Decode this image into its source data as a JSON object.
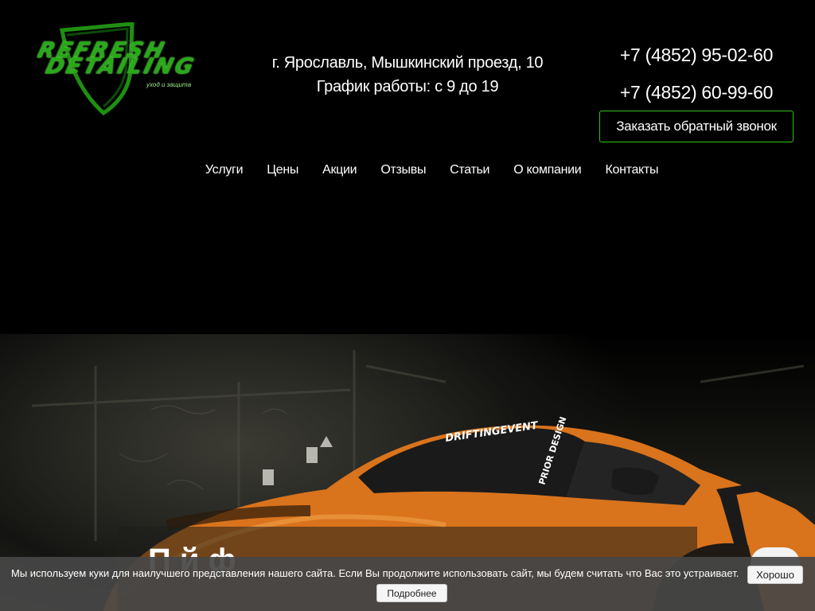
{
  "logo": {
    "word1": "REFRESH",
    "word2": "DETAILING",
    "tagline": "уход и защита",
    "color": "#28a91a"
  },
  "address": {
    "street": "г. Ярославль, Мышкинский проезд, 10",
    "hours": "График работы: с 9 до 19"
  },
  "phones": [
    "+7 (4852) 95-02-60",
    "+7 (4852) 60-99-60"
  ],
  "callback": {
    "label": "Заказать обратный звонок",
    "border_color": "#34c11c"
  },
  "nav": {
    "items": [
      "Услуги",
      "Цены",
      "Акции",
      "Отзывы",
      "Статьи",
      "О компании",
      "Контакты"
    ]
  },
  "hero": {
    "title_partial": "П         й                              ф",
    "windshield_text": "DRIFTINGEVENT",
    "door_text": "PRIOR DESIGN",
    "car_color": "#d9731c"
  },
  "cookie": {
    "text": "Мы используем куки для наилучшего представления нашего сайта. Если Вы продолжите использовать сайт, мы будем считать что Вас это устраивает.",
    "ok_label": "Хорошо",
    "more_label": "Подробнее"
  }
}
